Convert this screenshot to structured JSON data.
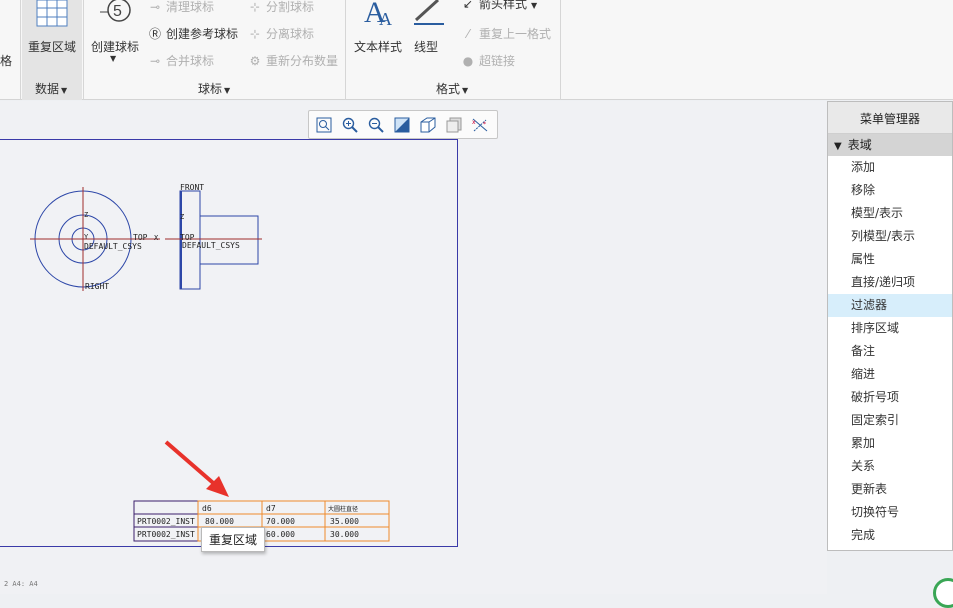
{
  "ribbon": {
    "left_partial_label": "格",
    "data_group": {
      "repeat_region_label": "重复区域",
      "group_label": "数据"
    },
    "balloon_group": {
      "create_balloon_label": "创建球标",
      "clear_balloon_label": "清理球标",
      "create_ref_balloon_label": "创建参考球标",
      "merge_balloon_label": "合并球标",
      "split_balloon_label": "分割球标",
      "detach_balloon_label": "分离球标",
      "redistribute_label": "重新分布数量",
      "group_label": "球标"
    },
    "format_group": {
      "text_style_label": "文本样式",
      "line_style_label": "线型",
      "arrow_style_label": "箭头样式",
      "repeat_last_format_label": "重复上一格式",
      "hyperlink_label": "超链接",
      "group_label": "格式"
    }
  },
  "drawing": {
    "labels": {
      "front": "FRONT",
      "right": "RIGHT",
      "top1": "TOP",
      "top2": "TOP",
      "csys1": "DEFAULT_CSYS",
      "csys2": "DEFAULT_CSYS",
      "x": "X",
      "y": "Y",
      "z": "Z",
      "z2": "Z"
    },
    "table": {
      "headers": [
        "",
        "d6",
        "d7",
        "大圆柱直径"
      ],
      "rows": [
        [
          "PRT0002_INST",
          "80.000",
          "70.000",
          "35.000"
        ],
        [
          "PRT0002_INST",
          "",
          "60.000",
          "30.000"
        ]
      ]
    }
  },
  "tooltip": "重复区域",
  "status_text": "2  A4: A4",
  "menu_manager": {
    "title": "菜单管理器",
    "section": "表域",
    "items": [
      {
        "label": "添加"
      },
      {
        "label": "移除"
      },
      {
        "label": "模型/表示"
      },
      {
        "label": "列模型/表示"
      },
      {
        "label": "属性"
      },
      {
        "label": "直接/递归项"
      },
      {
        "label": "过滤器"
      },
      {
        "label": "排序区域"
      },
      {
        "label": "备注"
      },
      {
        "label": "缩进"
      },
      {
        "label": "破折号项"
      },
      {
        "label": "固定索引"
      },
      {
        "label": "累加"
      },
      {
        "label": "关系"
      },
      {
        "label": "更新表"
      },
      {
        "label": "切换符号"
      },
      {
        "label": "完成"
      }
    ],
    "selected_index": 6
  },
  "colors": {
    "selection": "#d7eefb",
    "sheet_border": "#3a3aa8",
    "table_highlight": "#f08a2a",
    "arrow": "#e8322b"
  }
}
